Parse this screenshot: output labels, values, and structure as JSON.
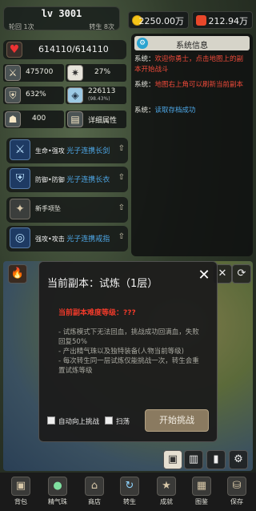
{
  "header": {
    "level": "lv 3001",
    "reincarnation": "轮回 1次",
    "rebirth": "转生 8次",
    "gold": "2250.00万",
    "gems": "212.94万"
  },
  "hp": {
    "value": "614110/614110",
    "icon": "heart-icon"
  },
  "stats": {
    "attack": "475700",
    "crit": "27%",
    "defense": "632%",
    "power": "226113",
    "power_sub": "(98.43%)",
    "misc": "400",
    "details_label": "详细属性"
  },
  "equipment": [
    {
      "type": "生命•强攻",
      "name": "光子连携长剑",
      "icon": "sword-icon"
    },
    {
      "type": "防御•防御",
      "name": "光子连携长衣",
      "icon": "armor-icon"
    },
    {
      "type": "新手项坠",
      "name": "",
      "icon": "amulet-icon"
    },
    {
      "type": "强攻•攻击",
      "name": "光子连携戒指",
      "icon": "ring-icon"
    }
  ],
  "system": {
    "title": "系统信息",
    "messages": [
      {
        "label": "系统：",
        "text": "欢迎你勇士，点击地图上的副本开始战斗",
        "color": "red"
      },
      {
        "label": "系统：",
        "text": "地图右上角可以刷新当前副本",
        "color": "red"
      },
      {
        "label": "系统：",
        "text": "读取存档成功",
        "color": "blue"
      }
    ]
  },
  "modal": {
    "title": "当前副本：试炼（1层）",
    "difficulty": "当前副本难度等级：???",
    "desc": [
      "- 试炼模式下无法回血，挑战成功回满血，失败",
      "回复50%",
      "- 产出精气珠以及独特装备(人物当前等级)",
      "- 每次转生同一层试炼仅能挑战一次，转生会重",
      "置试炼等级"
    ],
    "auto_label": "自动向上挑战",
    "sweep_label": "扫荡",
    "start_label": "开始挑战"
  },
  "nav": [
    {
      "label": "背包",
      "icon": "bag-icon"
    },
    {
      "label": "精气珠",
      "icon": "orb-icon"
    },
    {
      "label": "商店",
      "icon": "shop-icon"
    },
    {
      "label": "转生",
      "icon": "rebirth-icon"
    },
    {
      "label": "成就",
      "icon": "achievement-icon"
    },
    {
      "label": "图鉴",
      "icon": "codex-icon"
    },
    {
      "label": "保存",
      "icon": "save-icon"
    }
  ],
  "colors": {
    "accent": "#8a7a60",
    "danger": "#f03a2a",
    "info": "#4ea8e8"
  }
}
